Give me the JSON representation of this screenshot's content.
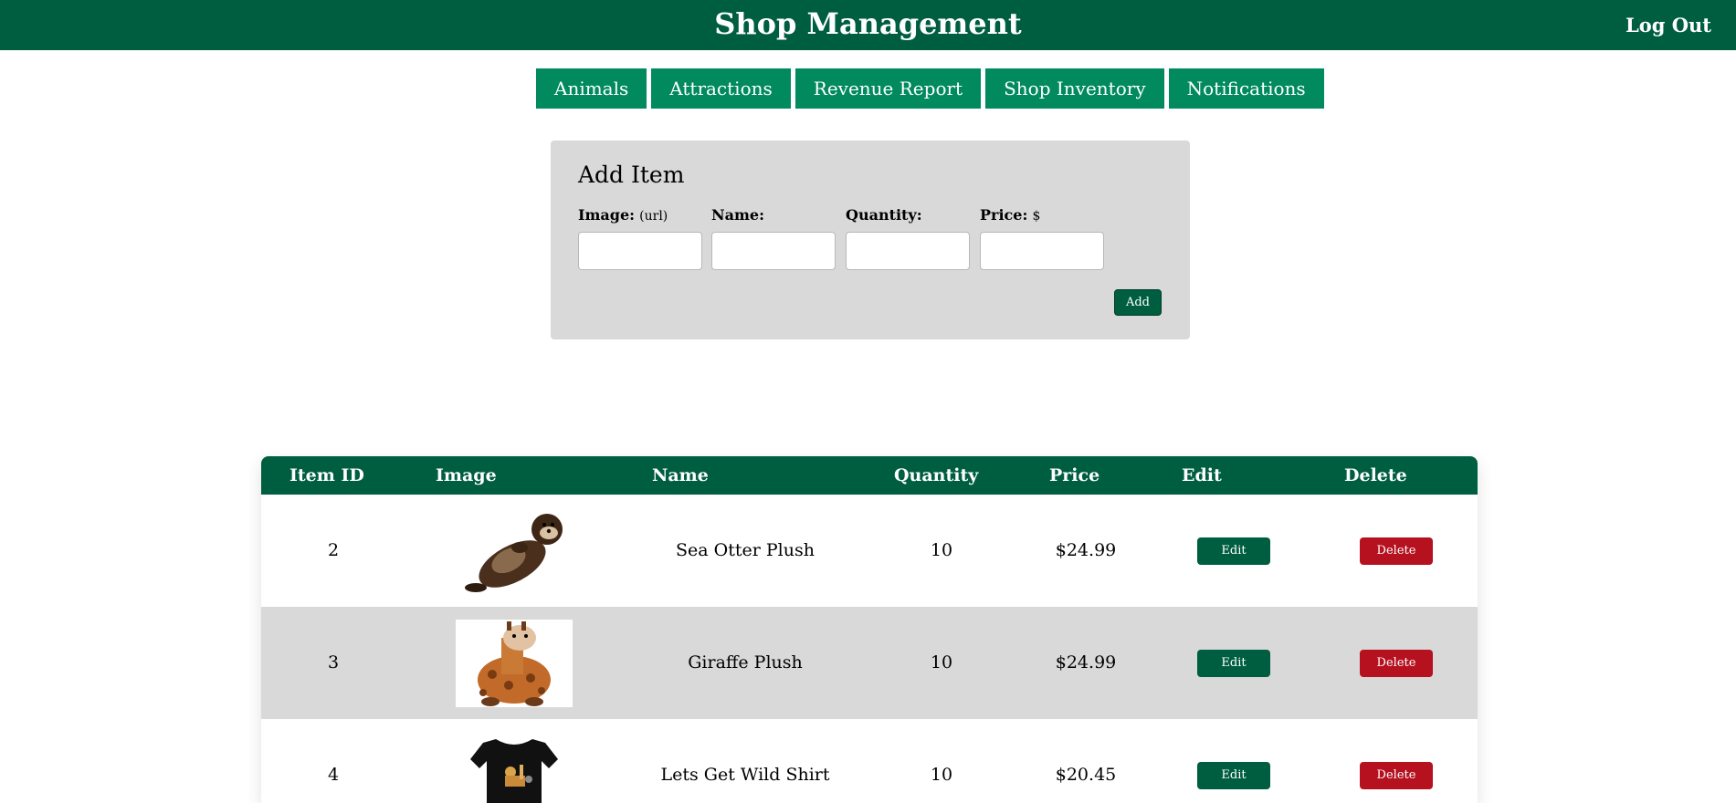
{
  "header": {
    "title": "Shop Management",
    "logout_label": "Log Out"
  },
  "nav": {
    "tabs": [
      "Animals",
      "Attractions",
      "Revenue Report",
      "Shop Inventory",
      "Notifications"
    ]
  },
  "add_item": {
    "heading": "Add Item",
    "fields": [
      {
        "label": "Image:",
        "hint": "(url)",
        "value": ""
      },
      {
        "label": "Name:",
        "hint": "",
        "value": ""
      },
      {
        "label": "Quantity:",
        "hint": "",
        "value": ""
      },
      {
        "label": "Price:",
        "hint": "$",
        "value": ""
      }
    ],
    "add_label": "Add"
  },
  "table": {
    "headers": [
      "Item ID",
      "Image",
      "Name",
      "Quantity",
      "Price",
      "Edit",
      "Delete"
    ],
    "rows": [
      {
        "id": "2",
        "image": "sea-otter-plush",
        "name": "Sea Otter Plush",
        "quantity": "10",
        "price": "$24.99",
        "edit": "Edit",
        "delete": "Delete"
      },
      {
        "id": "3",
        "image": "giraffe-plush",
        "name": "Giraffe Plush",
        "quantity": "10",
        "price": "$24.99",
        "edit": "Edit",
        "delete": "Delete"
      },
      {
        "id": "4",
        "image": "wild-shirt",
        "name": "Lets Get Wild Shirt",
        "quantity": "10",
        "price": "$20.45",
        "edit": "Edit",
        "delete": "Delete"
      }
    ]
  },
  "colors": {
    "brand_green": "#005e40",
    "tab_green": "#008a5e",
    "delete_red": "#b5111f",
    "panel_gray": "#d9d9d9"
  }
}
